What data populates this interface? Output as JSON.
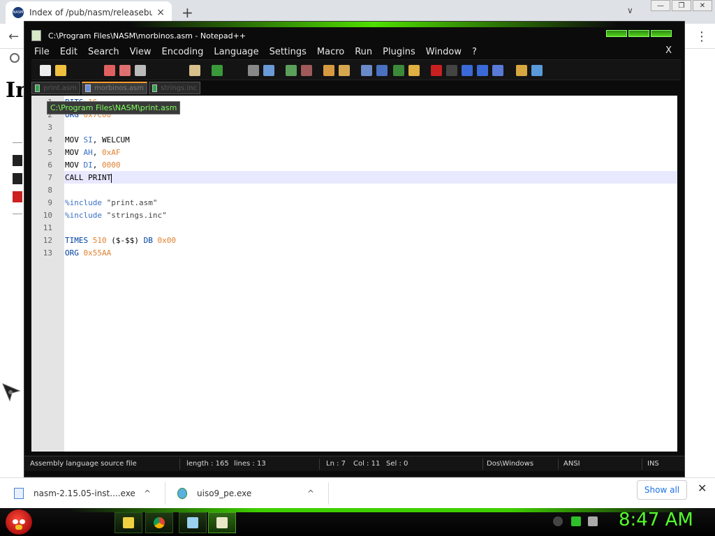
{
  "browser": {
    "tab_title": "Index of /pub/nasm/releasebuild",
    "tab_close": "×",
    "new_tab": "+",
    "tab_dropdown": "∨",
    "window_controls": [
      "—",
      "❐",
      "✕"
    ],
    "favicon_text": "NASM",
    "page_heading": "In"
  },
  "notepadpp": {
    "title": "C:\\Program Files\\NASM\\morbinos.asm - Notepad++",
    "menu": [
      "File",
      "Edit",
      "Search",
      "View",
      "Encoding",
      "Language",
      "Settings",
      "Macro",
      "Run",
      "Plugins",
      "Window",
      "?"
    ],
    "menu_close": "X",
    "tabs": [
      {
        "label": "print.asm",
        "active": false
      },
      {
        "label": "morbinos.asm",
        "active": true
      },
      {
        "label": "strings.inc",
        "active": false
      }
    ],
    "tooltip": "C:\\Program Files\\NASM\\print.asm",
    "line_numbers": [
      "1",
      "2",
      "3",
      "4",
      "5",
      "6",
      "7",
      "8",
      "9",
      "10",
      "11",
      "12",
      "13"
    ],
    "code": {
      "line1": {
        "kw": "BITS",
        "num": "16"
      },
      "line2": {
        "kw": "ORG",
        "num": "0x7C00"
      },
      "line4": {
        "kw": "MOV",
        "reg": "SI",
        "rest": ", WELCUM"
      },
      "line5": {
        "kw": "MOV",
        "reg": "AH",
        "sep": ", ",
        "num": "0xAF"
      },
      "line6": {
        "kw": "MOV",
        "reg": "DI",
        "sep": ", ",
        "num": "0000"
      },
      "line7": {
        "text": "CALL PRINT"
      },
      "line9": {
        "dir": "%include",
        "str": "\"print.asm\""
      },
      "line10": {
        "dir": "%include",
        "str": "\"strings.inc\""
      },
      "line12": {
        "kw": "TIMES",
        "num": "510",
        "mid": "($-$$)",
        "kw2": "DB",
        "num2": "0x00"
      },
      "line13": {
        "kw": "ORG",
        "num": "0x55AA"
      }
    },
    "status": {
      "filetype": "Assembly language source file",
      "length": "length : 165",
      "lines": "lines : 13",
      "ln": "Ln : 7",
      "col": "Col : 11",
      "sel": "Sel : 0",
      "eol": "Dos\\Windows",
      "encoding": "ANSI",
      "mode": "INS"
    },
    "colors": {
      "tab_accent": "#ff9d2a",
      "current_line": "#e8e8ff",
      "keyword": "#3a6fc4",
      "number": "#e08030"
    }
  },
  "downloads": {
    "items": [
      {
        "name": "nasm-2.15.05-inst....exe",
        "chevron": "^"
      },
      {
        "name": "uiso9_pe.exe",
        "chevron": "^"
      }
    ],
    "show_all": "Show all",
    "close": "✕"
  },
  "taskbar": {
    "clock": "8:47 AM",
    "apps": [
      "file-explorer-icon",
      "chrome-icon",
      "notepad-icon",
      "notepadpp-icon"
    ],
    "colors": {
      "accent": "#52ff28"
    }
  }
}
